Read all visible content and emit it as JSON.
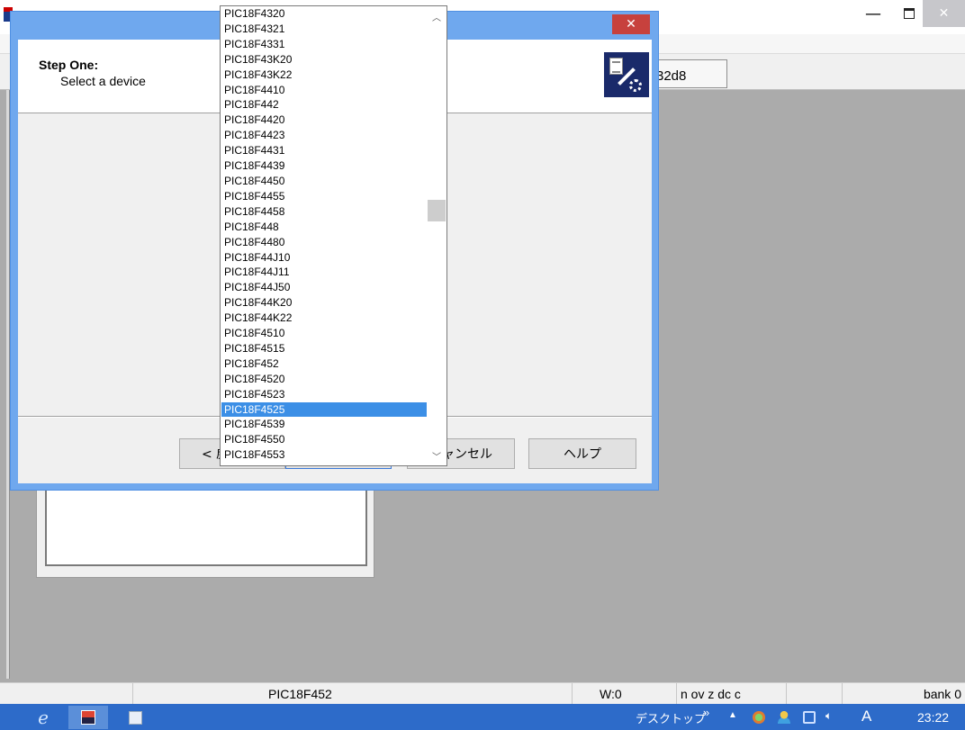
{
  "app": {
    "minimize_glyph": "—",
    "close_glyph": "✕",
    "hex_field_value": "32d8"
  },
  "dialog": {
    "close_glyph": "✕",
    "step_title": "Step One:",
    "step_subtitle": "Select a device",
    "buttons": {
      "back": "< 戻",
      "next": "",
      "cancel": "キャンセル",
      "help": "ヘルプ"
    }
  },
  "device_list": {
    "items": [
      "PIC18F4320",
      "PIC18F4321",
      "PIC18F4331",
      "PIC18F43K20",
      "PIC18F43K22",
      "PIC18F4410",
      "PIC18F442",
      "PIC18F4420",
      "PIC18F4423",
      "PIC18F4431",
      "PIC18F4439",
      "PIC18F4450",
      "PIC18F4455",
      "PIC18F4458",
      "PIC18F448",
      "PIC18F4480",
      "PIC18F44J10",
      "PIC18F44J11",
      "PIC18F44J50",
      "PIC18F44K20",
      "PIC18F44K22",
      "PIC18F4510",
      "PIC18F4515",
      "PIC18F452",
      "PIC18F4520",
      "PIC18F4523",
      "PIC18F4525",
      "PIC18F4539",
      "PIC18F4550",
      "PIC18F4553"
    ],
    "selected": "PIC18F4525",
    "scroll_up_glyph": "︿",
    "scroll_down_glyph": "﹀"
  },
  "status_bar": {
    "device": "PIC18F452",
    "w_register": "W:0",
    "flags": "n ov z dc c",
    "bank": "bank 0"
  },
  "taskbar": {
    "ie_glyph": "e",
    "desktop_label": "デスクトップ",
    "chevron": "»",
    "tray_up": "▲",
    "volume_glyph": "🔈︎",
    "ime": "A",
    "clock": "23:22"
  }
}
